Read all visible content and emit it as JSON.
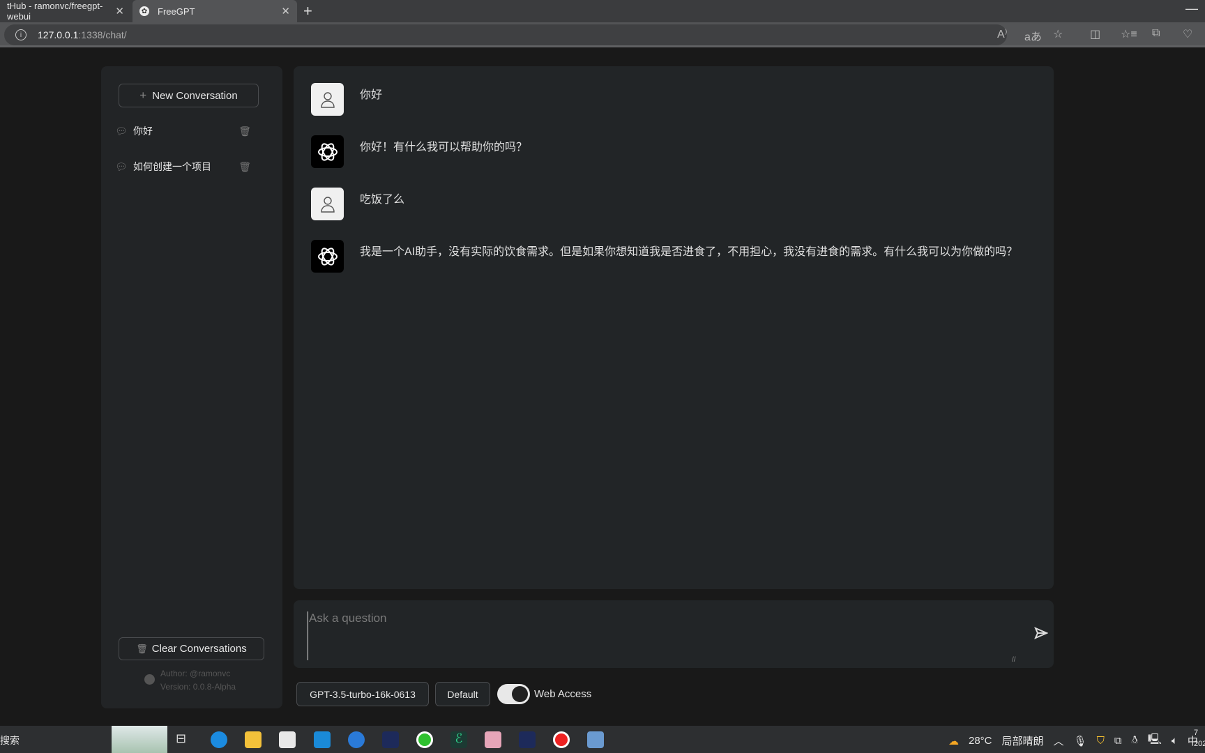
{
  "browser": {
    "tabs": [
      {
        "label": "tHub - ramonvc/freegpt-webui",
        "active": false
      },
      {
        "label": "FreeGPT",
        "active": true
      }
    ],
    "url_host": "127.0.0.1",
    "url_path": ":1338/chat/"
  },
  "sidebar": {
    "new_conversation": "New Conversation",
    "conversations": [
      {
        "title": "你好"
      },
      {
        "title": "如何创建一个项目"
      }
    ],
    "clear_conversations": "Clear Conversations",
    "author": "Author: @ramonvc",
    "version": "Version: 0.0.8-Alpha"
  },
  "chat": {
    "messages": [
      {
        "role": "user",
        "text": "你好"
      },
      {
        "role": "assistant",
        "text": "你好！有什么我可以帮助你的吗？"
      },
      {
        "role": "user",
        "text": "吃饭了么"
      },
      {
        "role": "assistant",
        "text": "我是一个AI助手，没有实际的饮食需求。但是如果你想知道我是否进食了，不用担心，我没有进食的需求。有什么我可以为你做的吗？"
      }
    ],
    "input_placeholder": "Ask a question",
    "input_value": ""
  },
  "controls": {
    "model": "GPT-3.5-turbo-16k-0613",
    "persona": "Default",
    "web_access_label": "Web Access",
    "web_access_enabled": true
  },
  "taskbar": {
    "search_label": "搜索",
    "weather_temp": "28°C",
    "weather_desc": "局部晴朗",
    "ime": "中",
    "clock_time": "7",
    "clock_date": "202"
  },
  "colors": {
    "sidebar_bg": "#222426",
    "chat_bg": "#222527",
    "page_bg": "#191919"
  }
}
